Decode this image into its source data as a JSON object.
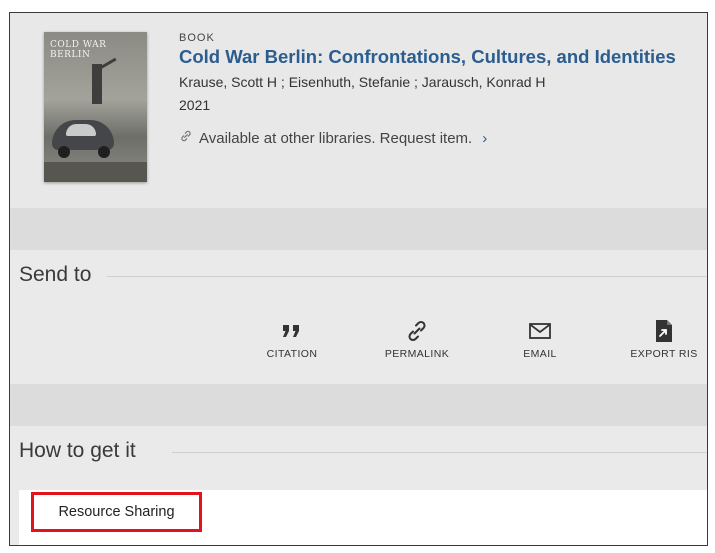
{
  "record": {
    "type": "BOOK",
    "title": "Cold War Berlin: Confrontations, Cultures, and Identities",
    "authors": "Krause, Scott H ; Eisenhuth, Stefanie ; Jarausch, Konrad H",
    "year": "2021",
    "availability": "Available at other libraries. Request item.",
    "availability_icon": "link-icon",
    "chevron": "›",
    "cover": {
      "title": "Cold War Berlin"
    }
  },
  "send_to": {
    "title": "Send to",
    "actions": [
      {
        "label": "CITATION",
        "icon": "quote-icon"
      },
      {
        "label": "PERMALINK",
        "icon": "link-icon"
      },
      {
        "label": "EMAIL",
        "icon": "envelope-icon"
      },
      {
        "label": "EXPORT RIS",
        "icon": "export-file-icon"
      }
    ]
  },
  "how_to_get": {
    "title": "How to get it",
    "button_label": "Resource Sharing"
  },
  "colors": {
    "title_link": "#2b5d8f",
    "highlight_border": "#e3121d",
    "panel_bg": "#e8e8e8"
  }
}
